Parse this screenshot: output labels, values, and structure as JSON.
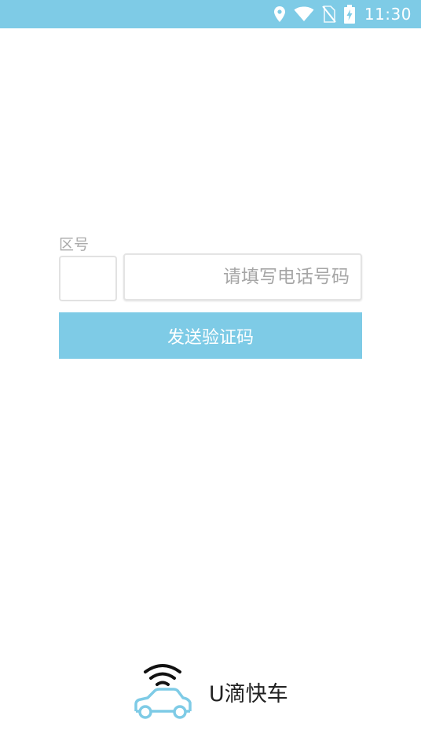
{
  "status_bar": {
    "time": "11:30",
    "icons": [
      "location-icon",
      "wifi-icon",
      "no-sim-icon",
      "battery-charging-icon"
    ],
    "background": "#7ecbe6"
  },
  "login_form": {
    "area_code_label": "区号",
    "area_code_value": "",
    "phone_placeholder": "请填写电话号码",
    "phone_value": "",
    "send_code_label": "发送验证码"
  },
  "brand": {
    "name": "U滴快车",
    "logo_icon": "car-wifi-icon",
    "accent_color": "#7ecbe6"
  }
}
